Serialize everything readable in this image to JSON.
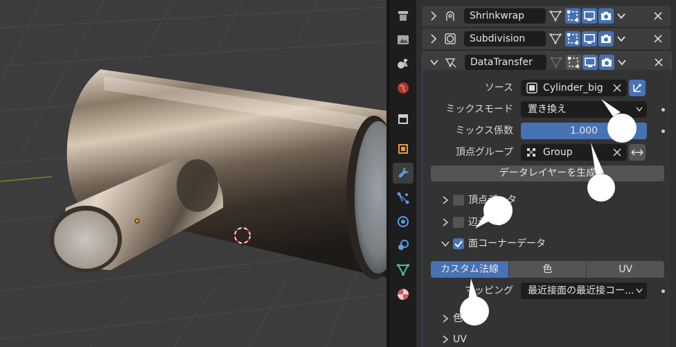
{
  "modifiers": [
    {
      "name": "Shrinkwrap",
      "icon": "shrinkwrap-icon",
      "expanded": false
    },
    {
      "name": "Subdivision",
      "icon": "subdivision-icon",
      "expanded": false
    },
    {
      "name": "DataTransfer",
      "icon": "datatransfer-icon",
      "expanded": true
    }
  ],
  "datatransfer": {
    "source_label": "ソース",
    "source_value": "Cylinder_big",
    "mix_mode_label": "ミックスモード",
    "mix_mode_value": "置き換え",
    "mix_factor_label": "ミックス係数",
    "mix_factor_value": "1.000",
    "mix_factor_fraction": 1.0,
    "vertex_group_label": "頂点グループ",
    "vertex_group_value": "Group",
    "generate_layers_button": "データレイヤーを生成",
    "sections": [
      {
        "label": "頂点データ",
        "checked": false,
        "expanded": false
      },
      {
        "label": "辺データ",
        "checked": false,
        "expanded": false
      },
      {
        "label": "面コーナーデータ",
        "checked": true,
        "expanded": true
      }
    ],
    "corner_tabs": [
      "カスタム法線",
      "色",
      "UV"
    ],
    "corner_tab_active": "カスタム法線",
    "mapping_label": "マッピング",
    "mapping_value": "最近接面の最近接コー...",
    "subpanels": [
      "色",
      "UV"
    ]
  },
  "colors": {
    "accent_blue": "#4772b3",
    "panel_bg": "#303030",
    "field_bg": "#1d1d1d",
    "viewport_bg": "#3c3c3c"
  },
  "property_tabs": [
    "tool-icon",
    "render-icon",
    "output-icon",
    "view-layer-icon",
    "scene-icon",
    "world-icon",
    "collection-icon",
    "object-icon",
    "modifier-icon",
    "particles-icon",
    "physics-icon",
    "constraints-icon",
    "data-icon",
    "material-icon"
  ]
}
